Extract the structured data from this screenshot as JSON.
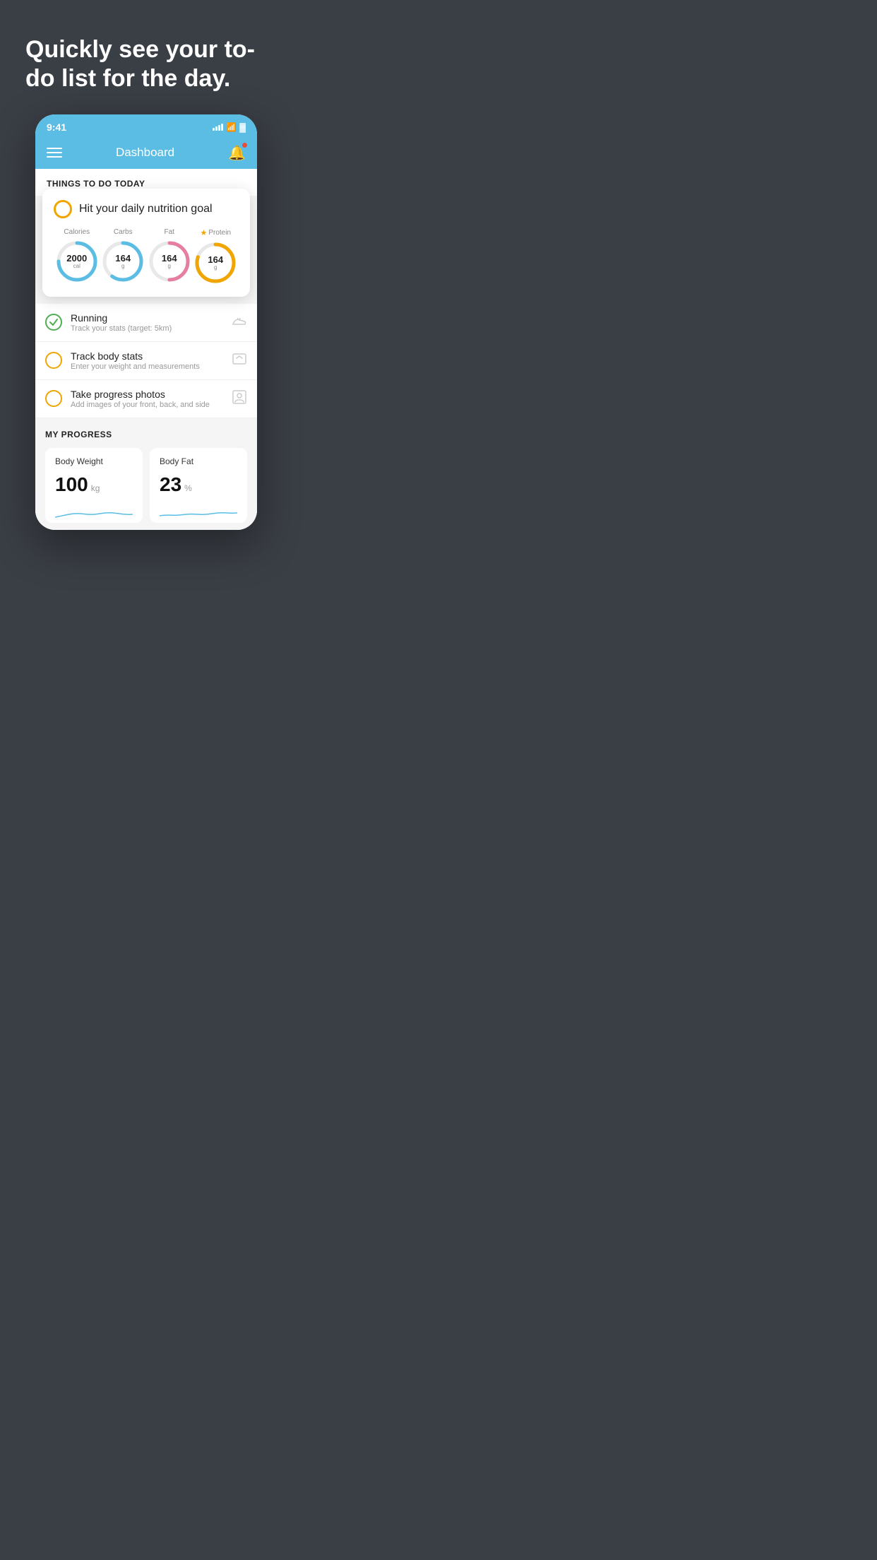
{
  "hero": {
    "title": "Quickly see your to-do list for the day."
  },
  "statusBar": {
    "time": "9:41",
    "signal": "signal",
    "wifi": "wifi",
    "battery": "battery"
  },
  "navBar": {
    "title": "Dashboard"
  },
  "section": {
    "thingsToDo": "THINGS TO DO TODAY"
  },
  "nutritionCard": {
    "title": "Hit your daily nutrition goal",
    "items": [
      {
        "label": "Calories",
        "value": "2000",
        "unit": "cal",
        "color": "#5bbde4",
        "track": 75
      },
      {
        "label": "Carbs",
        "value": "164",
        "unit": "g",
        "color": "#5bbde4",
        "track": 60
      },
      {
        "label": "Fat",
        "value": "164",
        "unit": "g",
        "color": "#e57ea0",
        "track": 50
      },
      {
        "label": "Protein",
        "value": "164",
        "unit": "g",
        "color": "#f0a500",
        "track": 80,
        "star": true
      }
    ]
  },
  "todoItems": [
    {
      "id": "running",
      "title": "Running",
      "subtitle": "Track your stats (target: 5km)",
      "circleColor": "green",
      "icon": "🏃"
    },
    {
      "id": "track-body-stats",
      "title": "Track body stats",
      "subtitle": "Enter your weight and measurements",
      "circleColor": "yellow",
      "icon": "⚖"
    },
    {
      "id": "progress-photos",
      "title": "Take progress photos",
      "subtitle": "Add images of your front, back, and side",
      "circleColor": "yellow",
      "icon": "👤"
    }
  ],
  "progress": {
    "sectionTitle": "MY PROGRESS",
    "cards": [
      {
        "title": "Body Weight",
        "value": "100",
        "unit": "kg"
      },
      {
        "title": "Body Fat",
        "value": "23",
        "unit": "%"
      }
    ]
  }
}
